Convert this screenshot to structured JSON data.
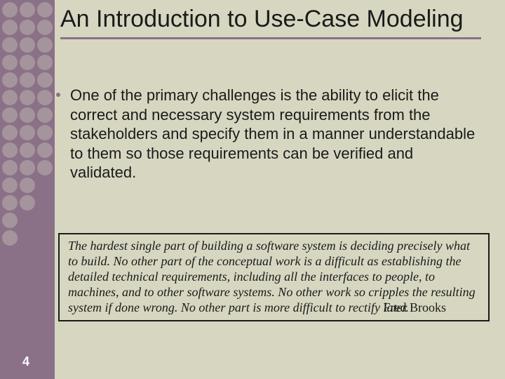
{
  "title": "An Introduction to Use-Case Modeling",
  "bullet": "One of the primary challenges is the ability to elicit the correct and necessary system requirements from the stakeholders and specify them in a manner understandable to them so those requirements can be verified and validated.",
  "quote": {
    "text": "The hardest single part of building a software system is deciding precisely what to build. No other part of the conceptual work is a difficult as establishing the detailed technical requirements, including all the interfaces to people, to machines, and to other software systems. No other work so cripples the resulting system if done wrong. No other part is more difficult to rectify later.",
    "author": "Fred Brooks"
  },
  "page_number": "4"
}
